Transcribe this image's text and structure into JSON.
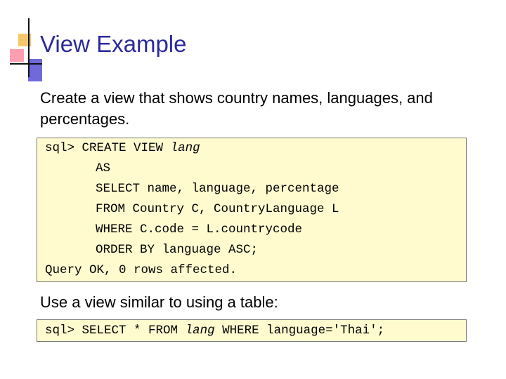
{
  "slide": {
    "title": "View Example",
    "intro": "Create a view that shows country names, languages, and percentages.",
    "code1": {
      "prompt": "sql>",
      "create_view": "CREATE VIEW",
      "view_name": "lang",
      "lines": [
        "AS",
        "SELECT name, language, percentage",
        "FROM Country C, CountryLanguage L",
        "WHERE C.code = L.countrycode",
        "ORDER BY language ASC;"
      ],
      "result": "Query OK, 0 rows affected."
    },
    "second_text": "Use a view similar to using a table:",
    "code2": {
      "prompt": "sql>",
      "select_part": "SELECT * FROM",
      "view_name": "lang",
      "where_part": "WHERE language='Thai';"
    }
  },
  "colors": {
    "title": "#2a2a9c",
    "code_background": "#fffbcf"
  }
}
